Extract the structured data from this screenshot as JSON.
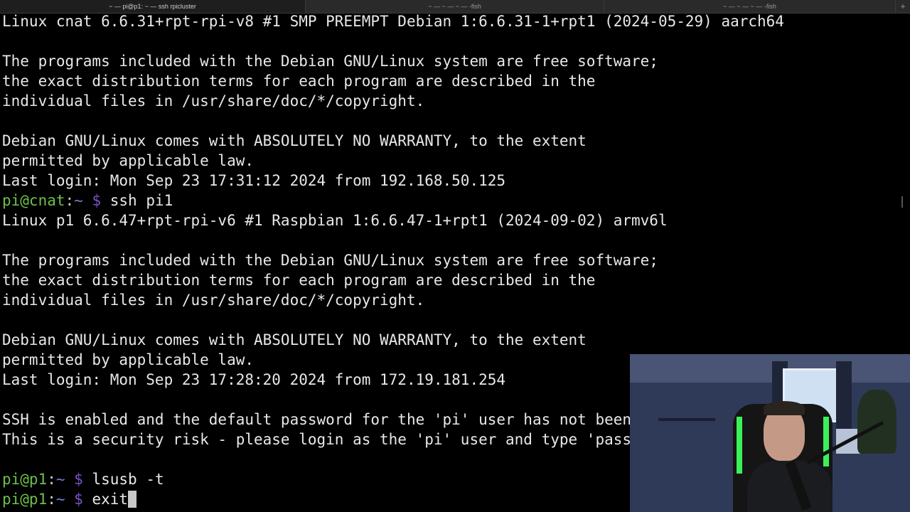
{
  "window": {
    "tabs": [
      {
        "label": "~ — pi@p1: ~ — ssh rpicluster",
        "active": true
      },
      {
        "label": "~ — ~ — ~ — -fish",
        "active": false
      },
      {
        "label": "~ — ~ — ~ — -fish",
        "active": false
      }
    ],
    "new_tab_icon": "plus-icon"
  },
  "terminal": {
    "colors": {
      "background": "#000000",
      "foreground": "#e8e8e8",
      "prompt_user": "#6cc04a",
      "prompt_tilde": "#6c7bd8",
      "prompt_dollar": "#7a52c7"
    },
    "lines": [
      {
        "type": "text",
        "text": "Linux cnat 6.6.31+rpt-rpi-v8 #1 SMP PREEMPT Debian 1:6.6.31-1+rpt1 (2024-05-29) aarch64"
      },
      {
        "type": "text",
        "text": ""
      },
      {
        "type": "text",
        "text": "The programs included with the Debian GNU/Linux system are free software;"
      },
      {
        "type": "text",
        "text": "the exact distribution terms for each program are described in the"
      },
      {
        "type": "text",
        "text": "individual files in /usr/share/doc/*/copyright."
      },
      {
        "type": "text",
        "text": ""
      },
      {
        "type": "text",
        "text": "Debian GNU/Linux comes with ABSOLUTELY NO WARRANTY, to the extent"
      },
      {
        "type": "text",
        "text": "permitted by applicable law."
      },
      {
        "type": "text",
        "text": "Last login: Mon Sep 23 17:31:12 2024 from 192.168.50.125"
      },
      {
        "type": "prompt",
        "user": "pi@cnat",
        "sep": ":",
        "dir": "~",
        "dollar": " $ ",
        "cmd": "ssh pi1"
      },
      {
        "type": "text",
        "text": "Linux p1 6.6.47+rpt-rpi-v6 #1 Raspbian 1:6.6.47-1+rpt1 (2024-09-02) armv6l"
      },
      {
        "type": "text",
        "text": ""
      },
      {
        "type": "text",
        "text": "The programs included with the Debian GNU/Linux system are free software;"
      },
      {
        "type": "text",
        "text": "the exact distribution terms for each program are described in the"
      },
      {
        "type": "text",
        "text": "individual files in /usr/share/doc/*/copyright."
      },
      {
        "type": "text",
        "text": ""
      },
      {
        "type": "text",
        "text": "Debian GNU/Linux comes with ABSOLUTELY NO WARRANTY, to the extent"
      },
      {
        "type": "text",
        "text": "permitted by applicable law."
      },
      {
        "type": "text",
        "text": "Last login: Mon Sep 23 17:28:20 2024 from 172.19.181.254"
      },
      {
        "type": "text",
        "text": ""
      },
      {
        "type": "text",
        "text": "SSH is enabled and the default password for the 'pi' user has not been"
      },
      {
        "type": "text",
        "text": "This is a security risk - please login as the 'pi' user and type 'pass"
      },
      {
        "type": "text",
        "text": ""
      },
      {
        "type": "prompt",
        "user": "pi@p1",
        "sep": ":",
        "dir": "~",
        "dollar": " $ ",
        "cmd": "lsusb -t"
      },
      {
        "type": "prompt",
        "user": "pi@p1",
        "sep": ":",
        "dir": "~",
        "dollar": " $ ",
        "cmd": "exit",
        "cursor": true
      }
    ]
  },
  "webcam": {
    "description_icon": "webcam-feed-icon"
  }
}
